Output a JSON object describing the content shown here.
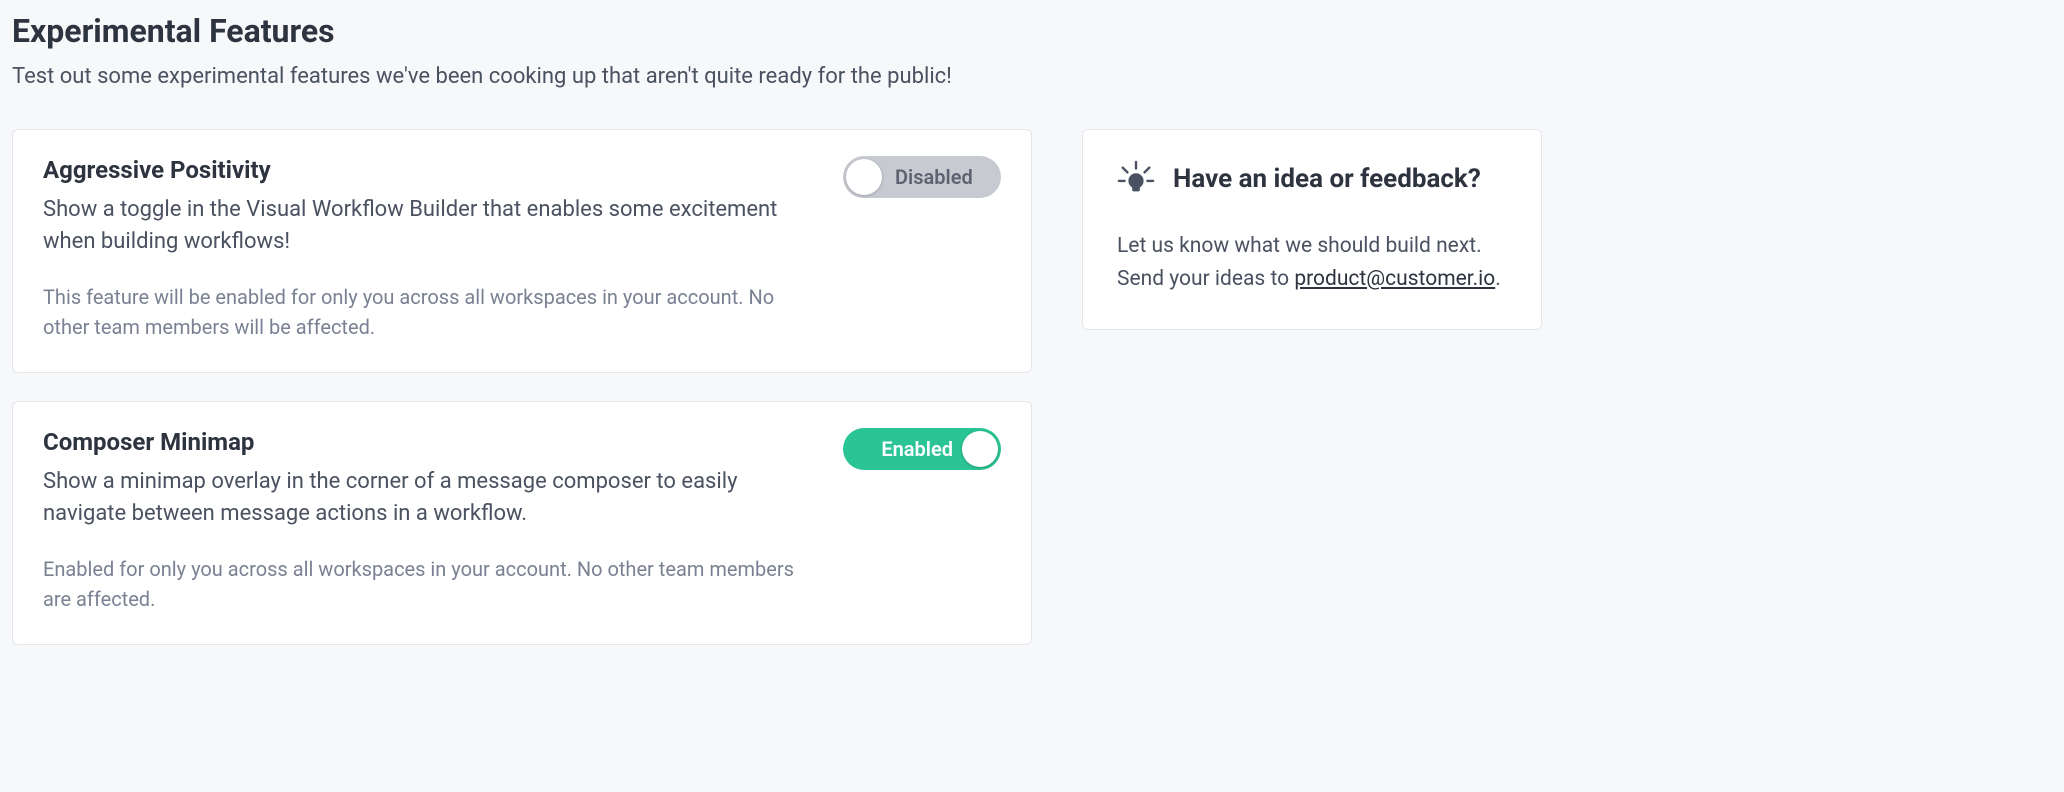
{
  "header": {
    "title": "Experimental Features",
    "subtitle": "Test out some experimental features we've been cooking up that aren't quite ready for the public!"
  },
  "features": [
    {
      "title": "Aggressive Positivity",
      "description": "Show a toggle in the Visual Workflow Builder that enables some excitement when building workflows!",
      "note": "This feature will be enabled for only you across all workspaces in your account. No other team members will be affected.",
      "enabled": false,
      "toggle_label": "Disabled"
    },
    {
      "title": "Composer Minimap",
      "description": "Show a minimap overlay in the corner of a message composer to easily navigate between message actions in a workflow.",
      "note": "Enabled for only you across all workspaces in your account. No other team members are affected.",
      "enabled": true,
      "toggle_label": "Enabled"
    }
  ],
  "feedback": {
    "title": "Have an idea or feedback?",
    "text_prefix": "Let us know what we should build next. Send your ideas to ",
    "email": "product@customer.io",
    "text_suffix": "."
  }
}
